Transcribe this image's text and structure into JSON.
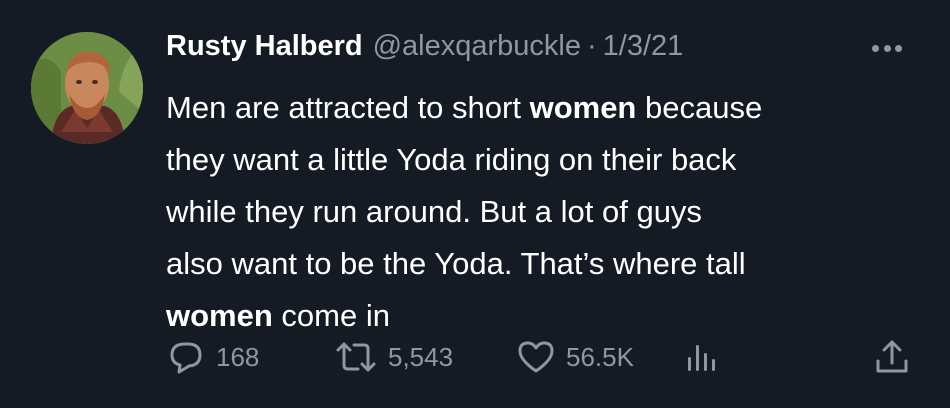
{
  "tweet": {
    "author_name": "Rusty Halberd",
    "handle": "@alexqarbuckle",
    "separator": "·",
    "date": "1/3/21",
    "text_lines": [
      {
        "pre": "Men are attracted to short ",
        "bold": "women",
        "post": " because"
      },
      {
        "pre": "they want a little Yoda riding on their back",
        "bold": "",
        "post": ""
      },
      {
        "pre": "while they run around. But a lot of guys",
        "bold": "",
        "post": ""
      },
      {
        "pre": "also want to be the Yoda. That’s where tall",
        "bold": "",
        "post": ""
      },
      {
        "pre": "",
        "bold": "women",
        "post": " come in"
      }
    ]
  },
  "actions": {
    "reply_count": "168",
    "retweet_count": "5,543",
    "like_count": "56.5K"
  },
  "icons": {
    "more": "more-horizontal-icon",
    "reply": "reply-icon",
    "retweet": "retweet-icon",
    "like": "heart-icon",
    "views": "views-icon",
    "share": "share-icon"
  },
  "colors": {
    "background": "#151b24",
    "text": "#ffffff",
    "secondary": "#8b98a5"
  }
}
